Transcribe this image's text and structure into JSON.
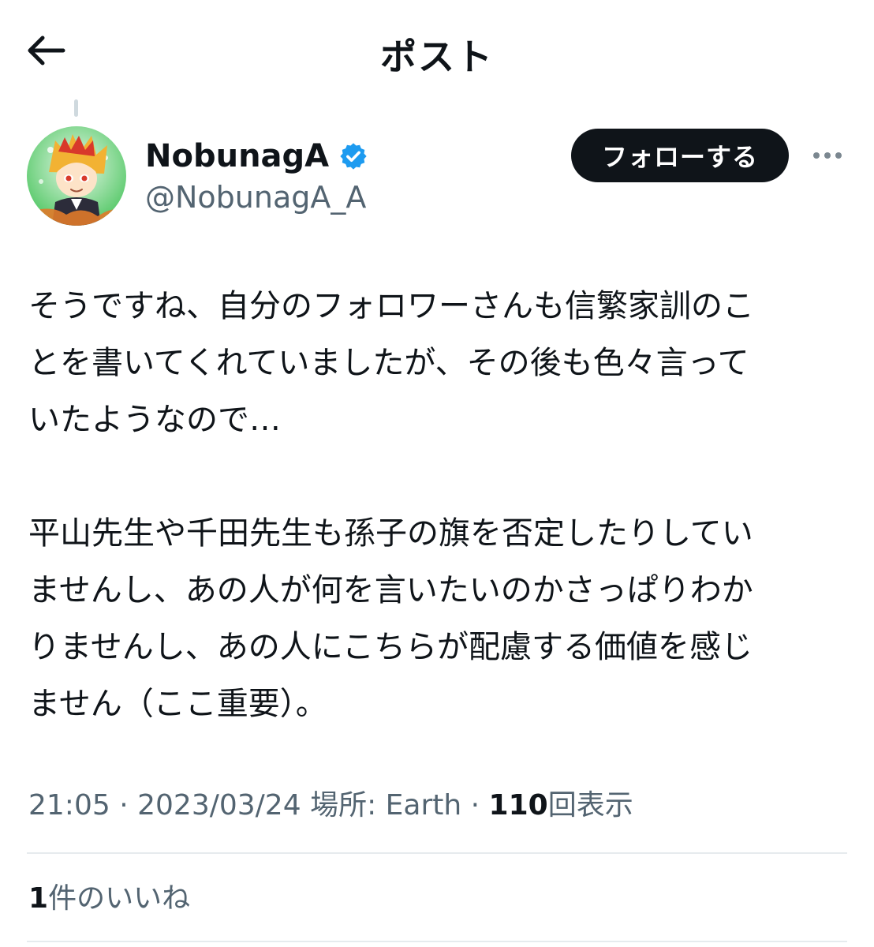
{
  "header": {
    "back_icon": "arrow-left-icon",
    "title": "ポスト"
  },
  "author": {
    "display_name": "NobunagA",
    "handle": "@NobunagA_A",
    "verified_icon": "verified-badge-icon",
    "verified_color": "#1d9bf0"
  },
  "actions": {
    "follow_label": "フォローする",
    "more_icon": "more-horizontal-icon"
  },
  "post": {
    "paragraph1_line1": "そうですね、自分のフォロワーさんも信繁家訓のこ",
    "paragraph1_line2": "とを書いてくれていましたが、その後も色々言って",
    "paragraph1_line3": "いたようなので…",
    "paragraph2_line1": "平山先生や千田先生も孫子の旗を否定したりしてい",
    "paragraph2_line2": "ませんし、あの人が何を言いたいのかさっぱりわか",
    "paragraph2_line3": "りませんし、あの人にこちらが配慮する価値を感じ",
    "paragraph2_line4": "ません（ここ重要）。"
  },
  "meta": {
    "time": "21:05",
    "separator": "·",
    "date": "2023/03/24",
    "location": "場所: Earth",
    "views_count": "110",
    "views_label": "回表示"
  },
  "likes": {
    "count": "1",
    "label": "件のいいね"
  }
}
